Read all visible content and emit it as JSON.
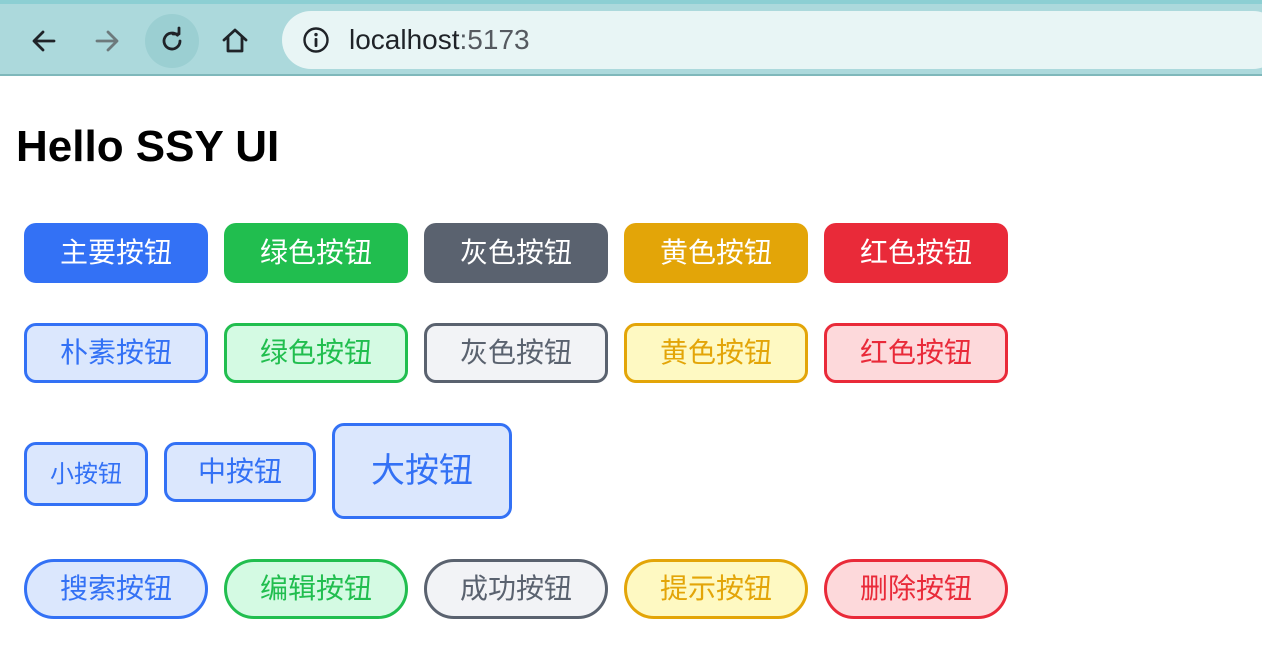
{
  "browser": {
    "url_host": "localhost",
    "url_port": ":5173",
    "icons": [
      "back-arrow-icon",
      "forward-arrow-icon",
      "reload-icon",
      "home-icon",
      "info-icon"
    ]
  },
  "page": {
    "title": "Hello SSY UI"
  },
  "colors": {
    "primary": "#3371f5",
    "success": "#21be4f",
    "info": "#5a626f",
    "warning": "#e3a508",
    "danger": "#e92a39"
  },
  "rows": {
    "solid": [
      "主要按钮",
      "绿色按钮",
      "灰色按钮",
      "黄色按钮",
      "红色按钮"
    ],
    "plain": [
      "朴素按钮",
      "绿色按钮",
      "灰色按钮",
      "黄色按钮",
      "红色按钮"
    ],
    "sizes": [
      "小按钮",
      "中按钮",
      "大按钮"
    ],
    "round": [
      "搜索按钮",
      "编辑按钮",
      "成功按钮",
      "提示按钮",
      "删除按钮"
    ]
  }
}
